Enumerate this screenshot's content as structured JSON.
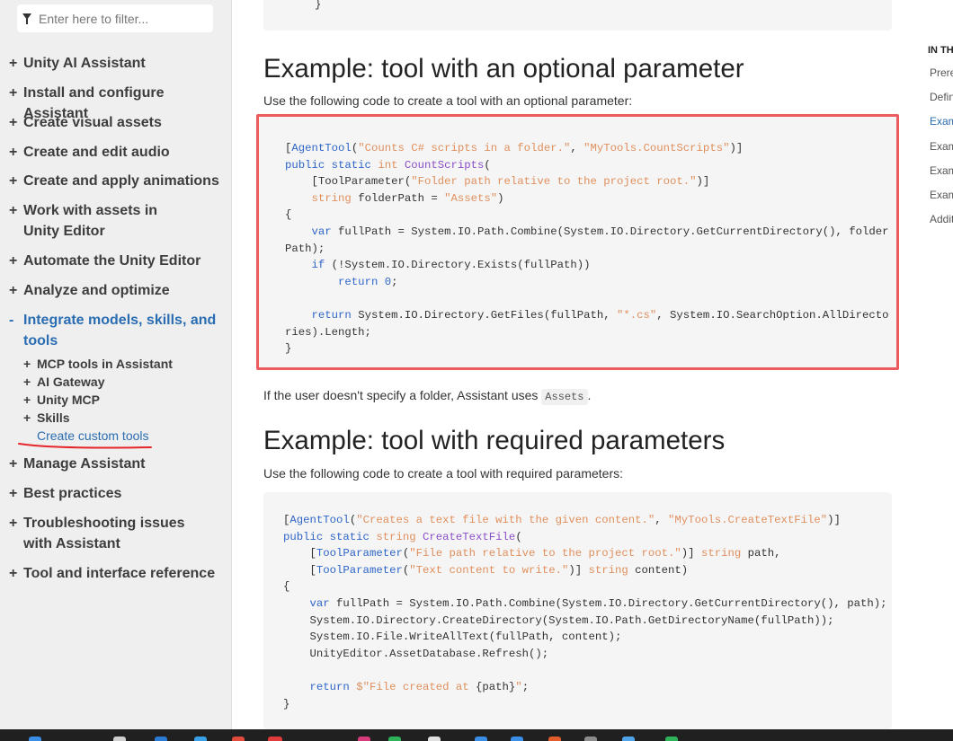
{
  "sidebar": {
    "filter_placeholder": "Enter here to filter...",
    "items": [
      {
        "symbol": "+",
        "label": "Unity AI Assistant"
      },
      {
        "symbol": "+",
        "label": "Install and configure Assistant"
      },
      {
        "symbol": "+",
        "label": "Create visual assets"
      },
      {
        "symbol": "+",
        "label": "Create and edit audio"
      },
      {
        "symbol": "+",
        "label": "Create and apply animations"
      },
      {
        "symbol": "+",
        "label": "Work with assets in Unity Editor"
      },
      {
        "symbol": "+",
        "label": "Automate the Unity Editor"
      },
      {
        "symbol": "+",
        "label": "Analyze and optimize"
      },
      {
        "symbol": "-",
        "label": "Integrate models, skills, and tools"
      },
      {
        "symbol": "+",
        "label": "Manage Assistant"
      },
      {
        "symbol": "+",
        "label": "Best practices"
      },
      {
        "symbol": "+",
        "label": "Troubleshooting issues with Assistant"
      },
      {
        "symbol": "+",
        "label": "Tool and interface reference"
      }
    ],
    "sub_items": [
      {
        "symbol": "+",
        "label": "MCP tools in Assistant"
      },
      {
        "symbol": "+",
        "label": "AI Gateway"
      },
      {
        "symbol": "+",
        "label": "Unity MCP"
      },
      {
        "symbol": "+",
        "label": "Skills"
      },
      {
        "symbol": "",
        "label": "Create custom tools"
      }
    ]
  },
  "main": {
    "prev_code_tail": "}",
    "section_optional": {
      "heading": "Example: tool with an optional parameter",
      "intro": "Use the following code to create a tool with an optional parameter:",
      "note_before": "If the user doesn't specify a folder, Assistant uses",
      "note_code": "Assets",
      "note_after": "."
    },
    "section_required": {
      "heading": "Example: tool with required parameters",
      "intro": "Use the following code to create a tool with required parameters:"
    }
  },
  "toc": {
    "title": "IN THIS ARTICLE",
    "items": [
      "Prerequisites",
      "Define",
      "Example",
      "Example",
      "Example",
      "Example",
      "Additional"
    ]
  },
  "colors": {
    "accent": "#2a6db2",
    "highlight_border": "#ec5b5e",
    "code_bg": "#f5f5f5",
    "sidebar_bg": "#efefef"
  }
}
